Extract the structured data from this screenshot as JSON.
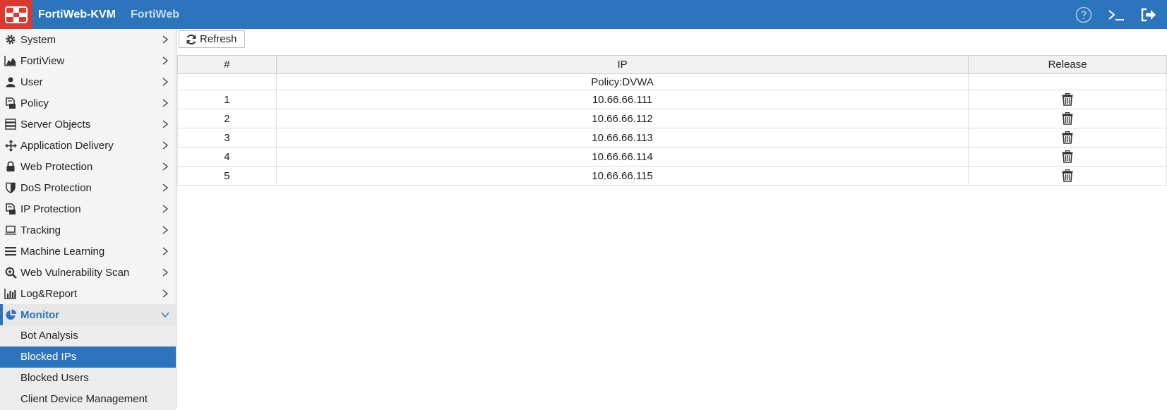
{
  "header": {
    "app_title": "FortiWeb-KVM",
    "product": "FortiWeb",
    "icons": [
      "help-icon",
      "cli-console-icon",
      "logout-icon"
    ]
  },
  "colors": {
    "header_bg": "#2c74bb",
    "logo_bg": "#da3a2f",
    "selected_bg": "#2c74bb",
    "active_text": "#2c74bb"
  },
  "sidebar": {
    "items": [
      {
        "label": "System",
        "icon": "gear-icon"
      },
      {
        "label": "FortiView",
        "icon": "area-chart-icon"
      },
      {
        "label": "User",
        "icon": "user-icon"
      },
      {
        "label": "Policy",
        "icon": "policy-icon"
      },
      {
        "label": "Server Objects",
        "icon": "server-icon"
      },
      {
        "label": "Application Delivery",
        "icon": "arrows-move-icon"
      },
      {
        "label": "Web Protection",
        "icon": "lock-icon"
      },
      {
        "label": "DoS Protection",
        "icon": "shield-icon"
      },
      {
        "label": "IP Protection",
        "icon": "ip-policy-icon"
      },
      {
        "label": "Tracking",
        "icon": "laptop-icon"
      },
      {
        "label": "Machine Learning",
        "icon": "bars-icon"
      },
      {
        "label": "Web Vulnerability Scan",
        "icon": "search-plus-icon"
      },
      {
        "label": "Log&Report",
        "icon": "bar-chart-icon"
      },
      {
        "label": "Monitor",
        "icon": "pie-chart-icon"
      }
    ],
    "monitor_children": [
      {
        "label": "Bot Analysis"
      },
      {
        "label": "Blocked IPs"
      },
      {
        "label": "Blocked Users"
      },
      {
        "label": "Client Device Management"
      }
    ]
  },
  "toolbar": {
    "refresh_label": "Refresh"
  },
  "table": {
    "columns": [
      "#",
      "IP",
      "Release"
    ],
    "group_label": "Policy:DVWA",
    "rows": [
      {
        "num": "1",
        "ip": "10.66.66.111"
      },
      {
        "num": "2",
        "ip": "10.66.66.112"
      },
      {
        "num": "3",
        "ip": "10.66.66.113"
      },
      {
        "num": "4",
        "ip": "10.66.66.114"
      },
      {
        "num": "5",
        "ip": "10.66.66.115"
      }
    ]
  }
}
